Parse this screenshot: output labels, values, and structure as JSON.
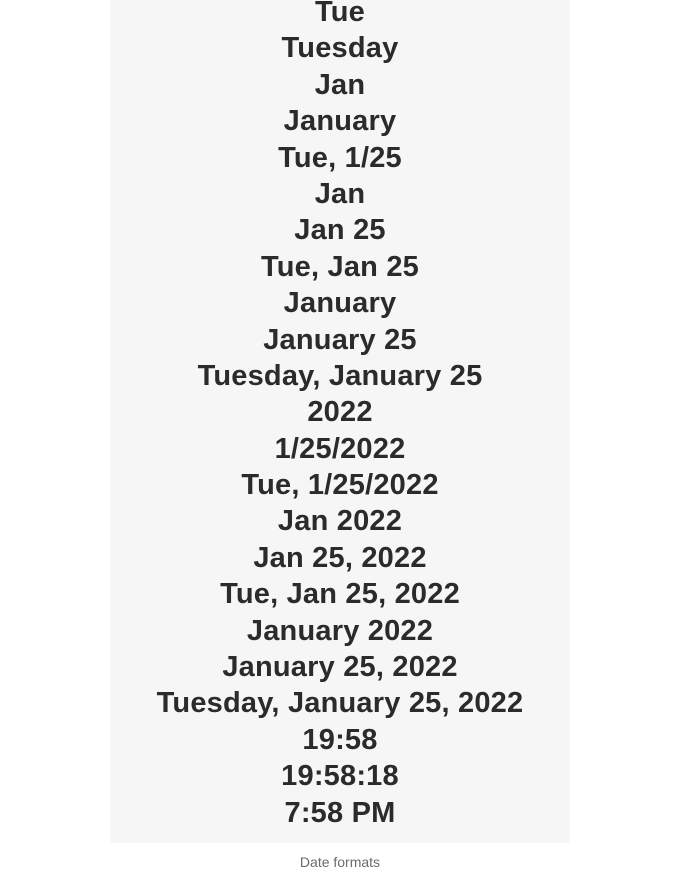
{
  "formats": [
    "Tue",
    "Tuesday",
    "Jan",
    "January",
    "Tue, 1/25",
    "Jan",
    "Jan 25",
    "Tue, Jan 25",
    "January",
    "January 25",
    "Tuesday, January 25",
    "2022",
    "1/25/2022",
    "Tue, 1/25/2022",
    "Jan 2022",
    "Jan 25, 2022",
    "Tue, Jan 25, 2022",
    "January 2022",
    "January 25, 2022",
    "Tuesday, January 25, 2022",
    "19:58",
    "19:58:18",
    "7:58 PM"
  ],
  "caption": "Date formats",
  "colors": {
    "panel_background": "#f6f6f6",
    "text": "#2b2b2b",
    "caption": "#6b6b6b"
  }
}
